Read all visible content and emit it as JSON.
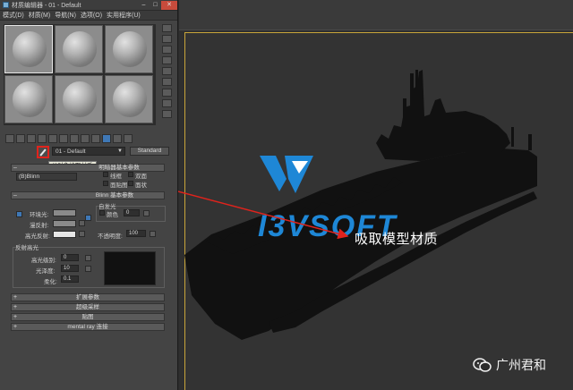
{
  "window": {
    "title": "材质编辑器 - 01 - Default",
    "menu": [
      "模式(D)",
      "材质(M)",
      "导航(N)",
      "选项(O)",
      "实用程序(U)"
    ]
  },
  "toolbar": {
    "material_name": "01 - Default",
    "material_type": "Standard",
    "tooltip": "从对象拾取材质"
  },
  "shader_basic": {
    "title": "明暗器基本参数",
    "shader": "(B)Blinn",
    "options": [
      "线框",
      "双面",
      "面贴图",
      "面状"
    ]
  },
  "blinn_basic": {
    "title": "Blinn 基本参数",
    "ambient_label": "环境光:",
    "diffuse_label": "漫反射:",
    "specular_label": "高光反射:",
    "self_illum_title": "自发光",
    "color_label": "颜色",
    "self_illum_value": "0",
    "opacity_label": "不透明度:",
    "opacity_value": "100",
    "specular_highlights_title": "反射高光",
    "spec_level_label": "高光级别:",
    "spec_level_value": "0",
    "glossiness_label": "光泽度:",
    "glossiness_value": "10",
    "soften_label": "柔化:",
    "soften_value": "0.1"
  },
  "rollouts": [
    "扩展参数",
    "超级采样",
    "贴图",
    "mental ray 连接"
  ],
  "overlay": {
    "logo_text": "I3VSOFT",
    "annotation": "吸取模型材质",
    "watermark": "广州君和"
  },
  "colors": {
    "logo_blue": "#1e87d6",
    "highlight_red": "#e0231c"
  }
}
